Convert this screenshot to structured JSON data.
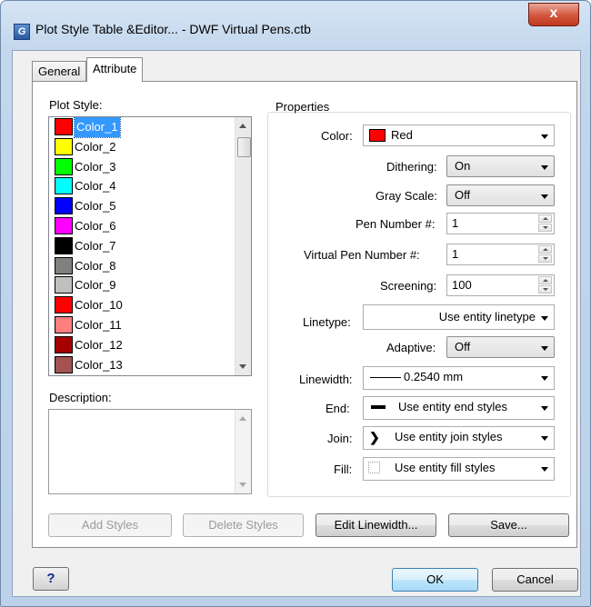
{
  "window": {
    "title": "Plot Style Table &Editor... - DWF Virtual Pens.ctb",
    "close_glyph": "x",
    "app_icon_glyph": "G"
  },
  "tabs": [
    {
      "label": "General"
    },
    {
      "label": "Attribute"
    }
  ],
  "plot_style": {
    "label": "Plot Style:",
    "items": [
      {
        "label": "Color_1",
        "color": "#ff0000"
      },
      {
        "label": "Color_2",
        "color": "#ffff00"
      },
      {
        "label": "Color_3",
        "color": "#00ff00"
      },
      {
        "label": "Color_4",
        "color": "#00ffff"
      },
      {
        "label": "Color_5",
        "color": "#0000ff"
      },
      {
        "label": "Color_6",
        "color": "#ff00ff"
      },
      {
        "label": "Color_7",
        "color": "#000000"
      },
      {
        "label": "Color_8",
        "color": "#808080"
      },
      {
        "label": "Color_9",
        "color": "#c0c0c0"
      },
      {
        "label": "Color_10",
        "color": "#ff0000"
      },
      {
        "label": "Color_11",
        "color": "#ff7f7f"
      },
      {
        "label": "Color_12",
        "color": "#a50000"
      },
      {
        "label": "Color_13",
        "color": "#a55252"
      }
    ]
  },
  "description": {
    "label": "Description:"
  },
  "properties": {
    "label": "Properties",
    "color": {
      "label": "Color:",
      "value": "Red",
      "swatch": "#ff0000"
    },
    "dithering": {
      "label": "Dithering:",
      "value": "On"
    },
    "gray_scale": {
      "label": "Gray Scale:",
      "value": "Off"
    },
    "pen_number": {
      "label": "Pen Number #:",
      "value": "1"
    },
    "virtual_pen_number": {
      "label": "Virtual Pen Number #:",
      "value": "1"
    },
    "screening": {
      "label": "Screening:",
      "value": "100"
    },
    "linetype": {
      "label": "Linetype:",
      "value": "Use entity linetype"
    },
    "adaptive": {
      "label": "Adaptive:",
      "value": "Off"
    },
    "linewidth": {
      "label": "Linewidth:",
      "value": "0.2540 mm"
    },
    "end": {
      "label": "End:",
      "value": "Use entity end styles"
    },
    "join": {
      "label": "Join:",
      "value": "Use entity join styles",
      "glyph": "❯"
    },
    "fill": {
      "label": "Fill:",
      "value": "Use entity fill styles"
    }
  },
  "buttons": {
    "add_styles": "Add Styles",
    "delete_styles": "Delete Styles",
    "edit_linewidth": "Edit Linewidth...",
    "save": "Save...",
    "help": "?",
    "ok": "OK",
    "cancel": "Cancel"
  }
}
